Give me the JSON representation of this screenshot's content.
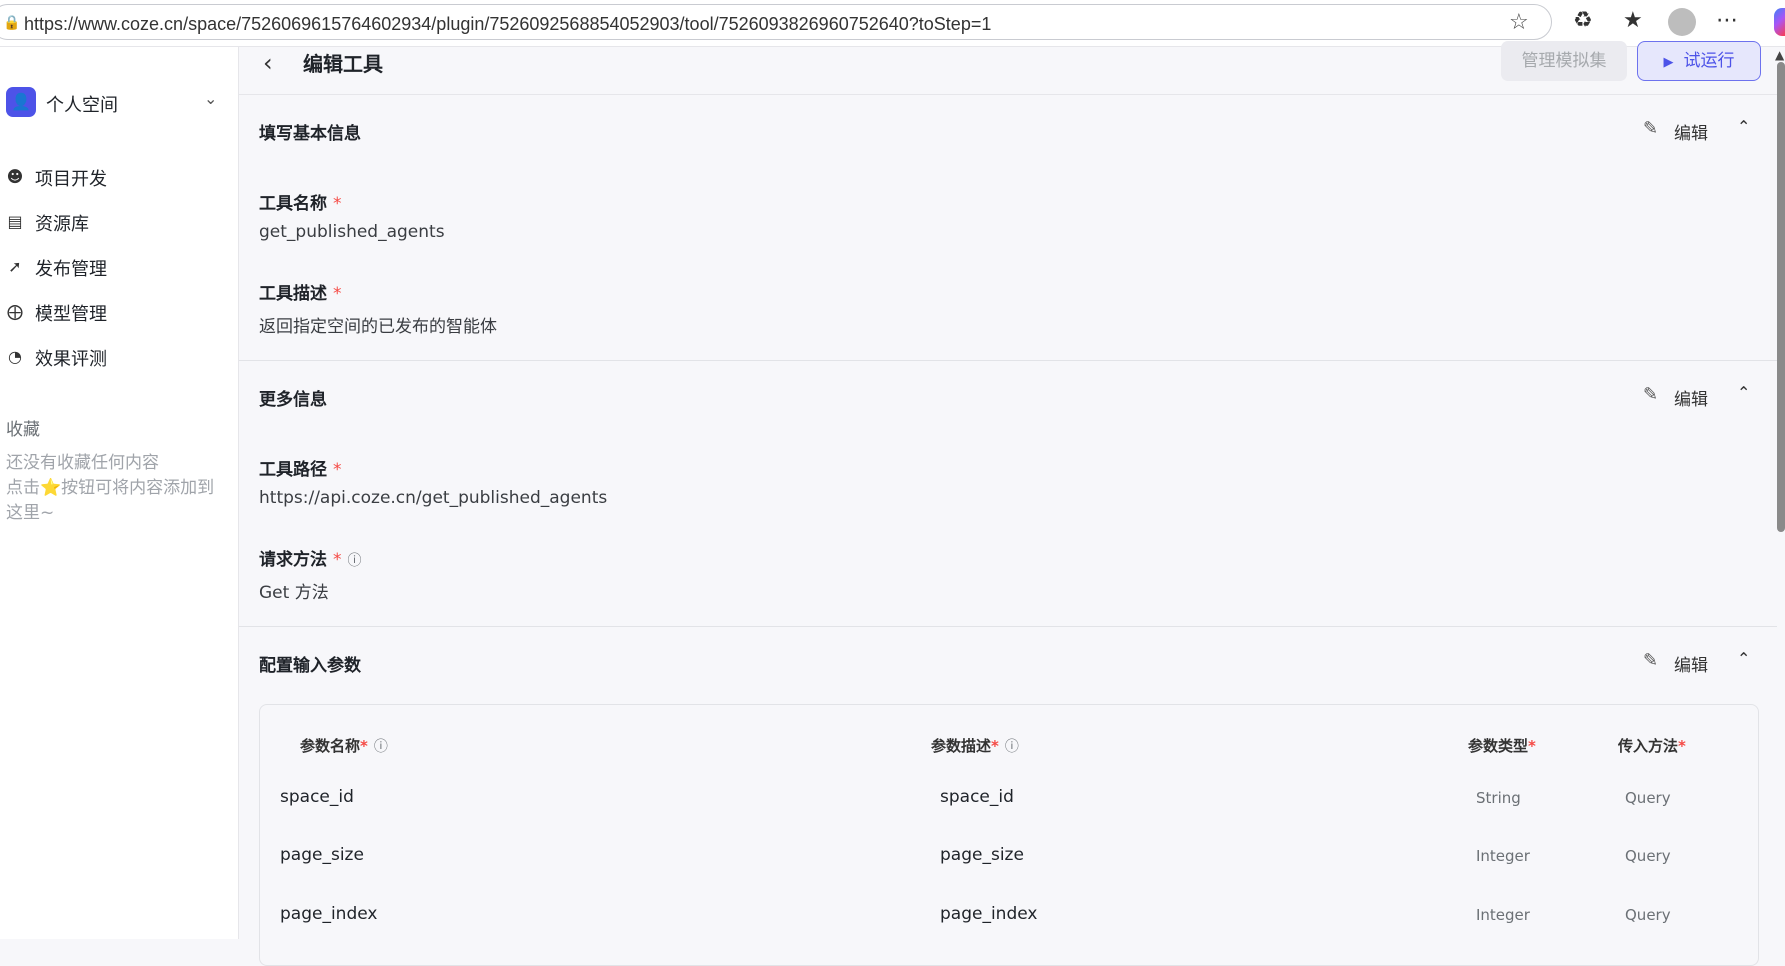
{
  "browser": {
    "url": "https://www.coze.cn/space/7526069615764602934/plugin/7526092568854052903/tool/7526093826960752640?toStep=1"
  },
  "sidebar": {
    "space_label": "个人空间",
    "items": [
      {
        "label": "项目开发",
        "icon": "bot-icon"
      },
      {
        "label": "资源库",
        "icon": "library-icon"
      },
      {
        "label": "发布管理",
        "icon": "rocket-icon"
      },
      {
        "label": "模型管理",
        "icon": "model-icon"
      },
      {
        "label": "效果评测",
        "icon": "gauge-icon"
      }
    ],
    "favorites_title": "收藏",
    "favorites_empty_line1": "还没有收藏任何内容",
    "favorites_empty_line2a": "点击",
    "favorites_empty_line2b": "按钮可将内容添加到",
    "favorites_empty_line3": "这里~"
  },
  "header": {
    "title": "编辑工具",
    "mock_button": "管理模拟集",
    "run_button": "试运行"
  },
  "sections": {
    "basic": {
      "title": "填写基本信息",
      "edit_label": "编辑",
      "name_label": "工具名称",
      "name_value": "get_published_agents",
      "desc_label": "工具描述",
      "desc_value": "返回指定空间的已发布的智能体"
    },
    "more": {
      "title": "更多信息",
      "edit_label": "编辑",
      "path_label": "工具路径",
      "path_value": "https://api.coze.cn/get_published_agents",
      "method_label": "请求方法",
      "method_value": "Get 方法"
    },
    "input": {
      "title": "配置输入参数",
      "edit_label": "编辑",
      "columns": {
        "name": "参数名称",
        "desc": "参数描述",
        "type": "参数类型",
        "method": "传入方法"
      },
      "rows": [
        {
          "name": "space_id",
          "desc": "space_id",
          "type": "String",
          "method": "Query"
        },
        {
          "name": "page_size",
          "desc": "page_size",
          "type": "Integer",
          "method": "Query"
        },
        {
          "name": "page_index",
          "desc": "page_index",
          "type": "Integer",
          "method": "Query"
        }
      ]
    }
  },
  "required_mark": "*"
}
